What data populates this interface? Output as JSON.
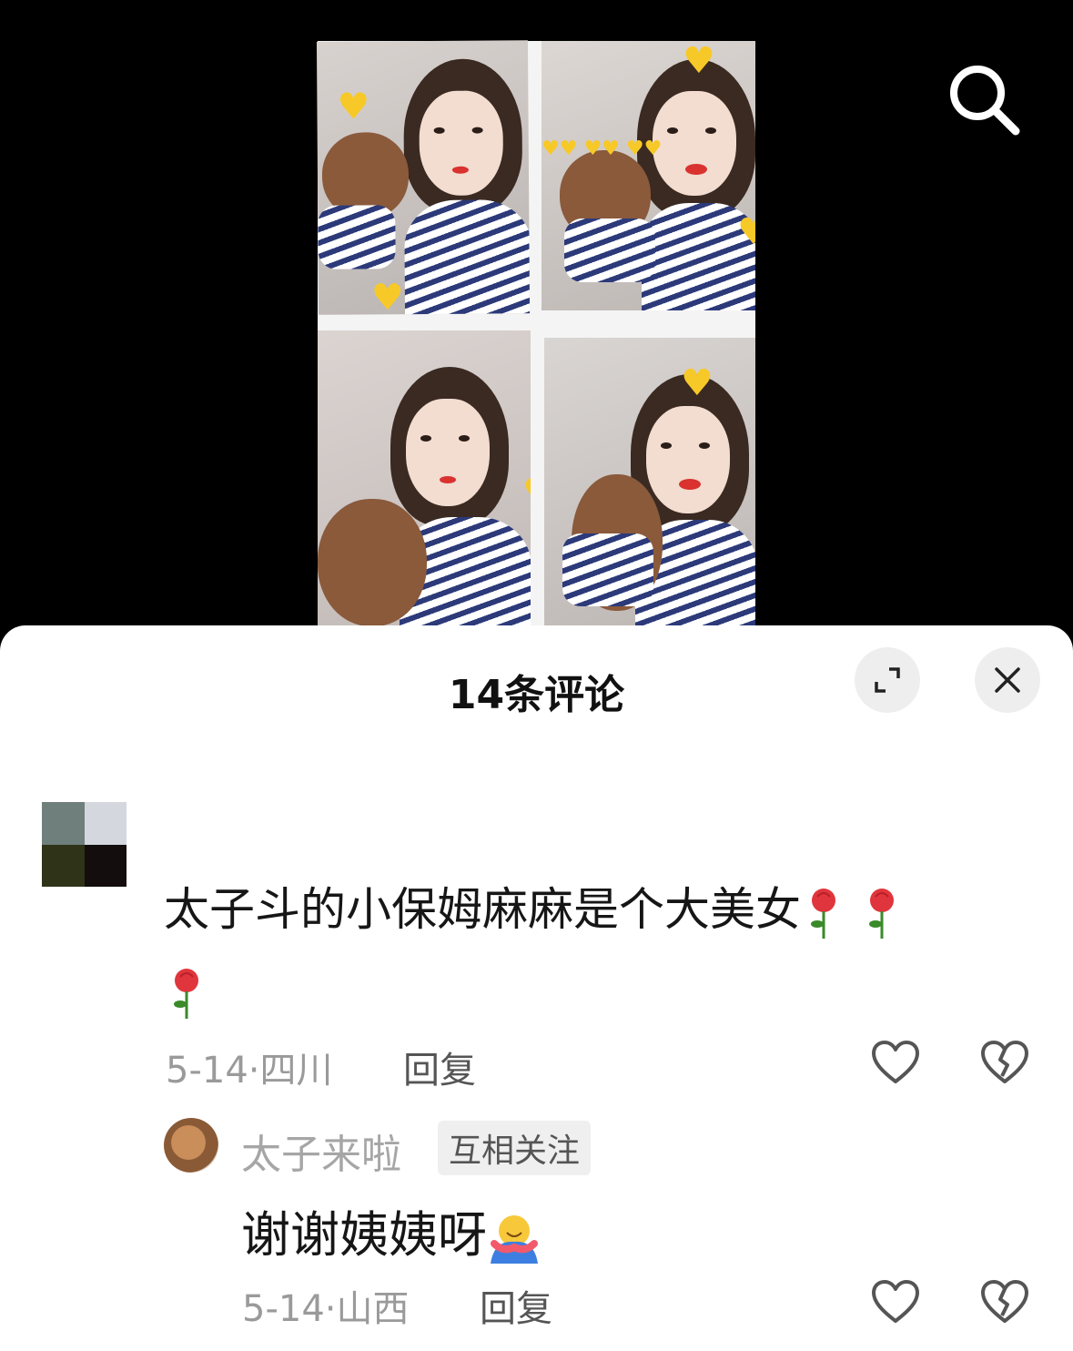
{
  "video": {
    "search_icon": "search-icon",
    "collage_panels": 4,
    "heart_color": "#f7c928"
  },
  "sheet": {
    "title": "14条评论",
    "expand_icon": "expand-icon",
    "close_icon": "close-icon"
  },
  "comment": {
    "text": "太子斗的小保姆麻麻是个大美女",
    "emojis": [
      "rose",
      "rose",
      "rose"
    ],
    "date": "5-14",
    "separator": "·",
    "location": "四川",
    "reply_label": "回复"
  },
  "reply": {
    "author": "太子来啦",
    "tag": "互相关注",
    "text": "谢谢姨姨呀",
    "emoji": "hug",
    "date": "5-14",
    "separator": "·",
    "location": "山西",
    "reply_label": "回复"
  }
}
